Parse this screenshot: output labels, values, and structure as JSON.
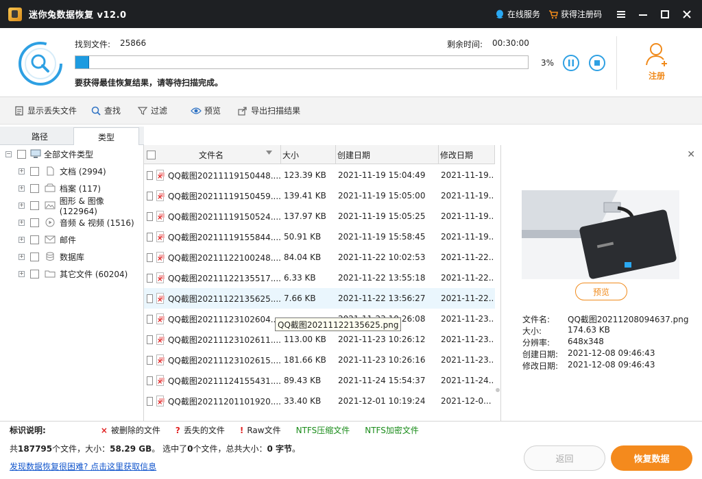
{
  "window": {
    "title": "迷你兔数据恢复 v12.0",
    "online_service": "在线服务",
    "get_code": "获得注册码"
  },
  "scan": {
    "found_label": "找到文件:",
    "found_count": "25866",
    "remain_label": "剩余时间:",
    "remain_time": "00:30:00",
    "percent": "3%",
    "progress": 0.03,
    "note": "要获得最佳恢复结果，请等待扫描完成。",
    "register": "注册"
  },
  "toolbar": {
    "show_lost": "显示丢失文件",
    "find": "查找",
    "filter": "过滤",
    "preview": "预览",
    "export": "导出扫描结果"
  },
  "tabs": {
    "path": "路径",
    "type": "类型"
  },
  "tree": {
    "root": "全部文件类型",
    "items": [
      {
        "label": "文档 (2994)",
        "icon": "document-icon"
      },
      {
        "label": "档案 (117)",
        "icon": "archive-icon"
      },
      {
        "label": "图形 & 图像 (122964)",
        "icon": "image-icon"
      },
      {
        "label": "音频 & 视频 (1516)",
        "icon": "media-icon"
      },
      {
        "label": "邮件",
        "icon": "mail-icon"
      },
      {
        "label": "数据库",
        "icon": "database-icon"
      },
      {
        "label": "其它文件 (60204)",
        "icon": "folder-icon"
      }
    ]
  },
  "list": {
    "headers": {
      "name": "文件名",
      "size": "大小",
      "created": "创建日期",
      "modified": "修改日期"
    },
    "rows": [
      {
        "name": "QQ截图20211119150448....",
        "size": "123.39 KB",
        "created": "2021-11-19 15:04:49",
        "modified": "2021-11-19..."
      },
      {
        "name": "QQ截图20211119150459....",
        "size": "139.41 KB",
        "created": "2021-11-19 15:05:00",
        "modified": "2021-11-19..."
      },
      {
        "name": "QQ截图20211119150524....",
        "size": "137.97 KB",
        "created": "2021-11-19 15:05:25",
        "modified": "2021-11-19..."
      },
      {
        "name": "QQ截图20211119155844....",
        "size": "50.91 KB",
        "created": "2021-11-19 15:58:45",
        "modified": "2021-11-19..."
      },
      {
        "name": "QQ截图20211122100248....",
        "size": "84.04 KB",
        "created": "2021-11-22 10:02:53",
        "modified": "2021-11-22..."
      },
      {
        "name": "QQ截图20211122135517....",
        "size": "6.33 KB",
        "created": "2021-11-22 13:55:18",
        "modified": "2021-11-22..."
      },
      {
        "name": "QQ截图20211122135625....",
        "size": "7.66 KB",
        "created": "2021-11-22 13:56:27",
        "modified": "2021-11-22..."
      },
      {
        "name": "QQ截图20211123102604....",
        "size": "",
        "created": "2021-11-23 10:26:08",
        "modified": "2021-11-23..."
      },
      {
        "name": "QQ截图20211123102611....",
        "size": "113.00 KB",
        "created": "2021-11-23 10:26:12",
        "modified": "2021-11-23..."
      },
      {
        "name": "QQ截图20211123102615....",
        "size": "181.66 KB",
        "created": "2021-11-23 10:26:16",
        "modified": "2021-11-23..."
      },
      {
        "name": "QQ截图20211124155431....",
        "size": "89.43 KB",
        "created": "2021-11-24 15:54:37",
        "modified": "2021-11-24..."
      },
      {
        "name": "QQ截图20211201101920....",
        "size": "33.40 KB",
        "created": "2021-12-01 10:19:24",
        "modified": "2021-12-0..."
      }
    ],
    "tooltip": "QQ截图20211122135625.png"
  },
  "preview": {
    "button": "预览",
    "labels": [
      "文件名:",
      "大小:",
      "分辨率:",
      "创建日期:",
      "修改日期:"
    ],
    "values": [
      "QQ截图20211208094637.png",
      "174.63 KB",
      "648x348",
      "2021-12-08 09:46:43",
      "2021-12-08 09:46:43"
    ]
  },
  "legend": {
    "label": "标识说明:",
    "deleted": "被删除的文件",
    "lost": "丢失的文件",
    "raw": "Raw文件",
    "ntfs_compressed": "NTFS压缩文件",
    "ntfs_encrypted": "NTFS加密文件"
  },
  "summary": {
    "total_prefix": "共",
    "total_count": "187795",
    "total_mid": "个文件，大小：",
    "total_size": "58.29 GB",
    "sel_prefix": "。 选中了",
    "sel_count": "0",
    "sel_mid": "个文件，总共大小：",
    "sel_size": "0 字节",
    "sel_suffix": "。"
  },
  "footer": {
    "help_link": "发现数据恢复很困难? 点击这里获取信息",
    "back": "返回",
    "recover": "恢复数据"
  },
  "colors": {
    "accent_orange": "#f48a1d",
    "accent_blue": "#1e9be0",
    "title_bg": "#1e2023"
  }
}
